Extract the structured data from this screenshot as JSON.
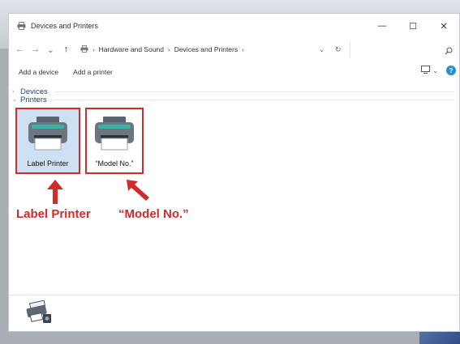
{
  "window": {
    "title": "Devices and Printers"
  },
  "titlebar_controls": {
    "minimize": "—",
    "maximize": "☐",
    "close": "✕"
  },
  "nav": {
    "back": "←",
    "forward": "→",
    "recent": "⌄",
    "up": "↑"
  },
  "breadcrumb": {
    "separator": "›",
    "items": [
      "Hardware and Sound",
      "Devices and Printers"
    ]
  },
  "addressbar": {
    "dropdown": "⌄",
    "refresh": "↻"
  },
  "search": {
    "placeholder": "",
    "icon": "search-icon"
  },
  "commands": {
    "add_device": "Add a device",
    "add_printer": "Add a printer"
  },
  "view": {
    "dropdown": "⌄"
  },
  "help": {
    "label": "?"
  },
  "groups": {
    "devices": {
      "label": "Devices",
      "chevron": "›"
    },
    "printers": {
      "label": "Printers",
      "chevron": "⌄"
    }
  },
  "printers": [
    {
      "name": "Label Printer",
      "selected": true
    },
    {
      "name": "“Model No.”",
      "selected": false
    }
  ],
  "annotations": [
    {
      "text": "Label Printer"
    },
    {
      "text": "“Model No.”"
    }
  ],
  "colors": {
    "annotation": "#d12b2b",
    "selection": "#cfe0f2",
    "accent": "#2a8bd9"
  }
}
